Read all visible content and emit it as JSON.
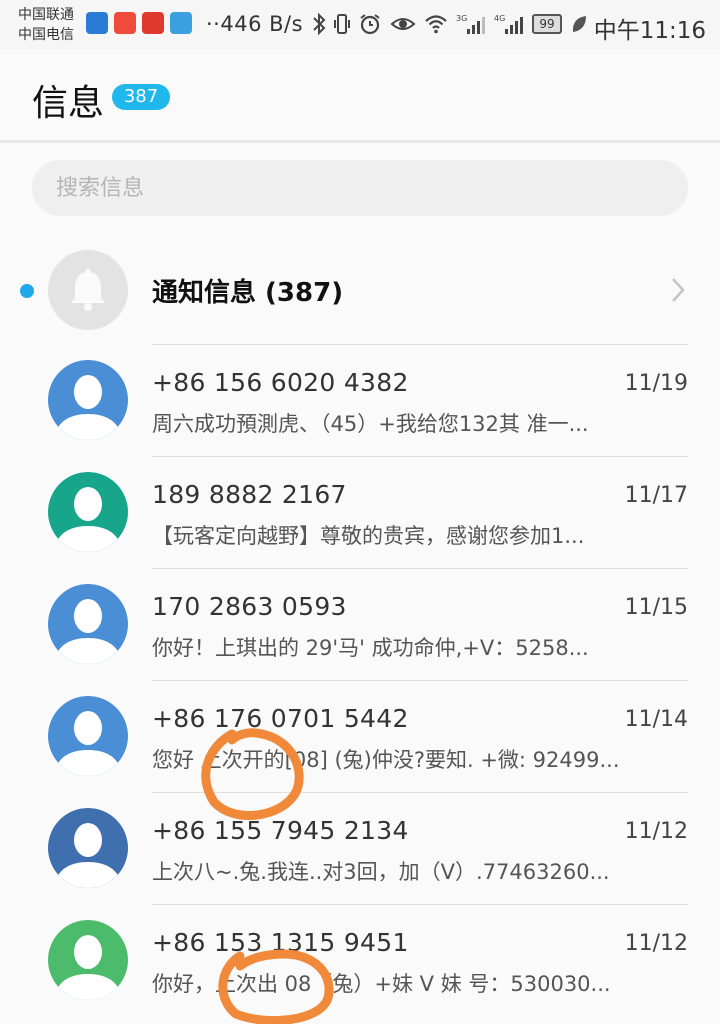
{
  "status_bar": {
    "carrier_1": "中国联通",
    "carrier_2": "中国电信",
    "net_speed": "··446 B/s",
    "battery": "99",
    "time": "中午11:16",
    "app_icon_colors": [
      "#2b7bd6",
      "#f04a3a",
      "#e03a2e",
      "#3aa0e0"
    ],
    "app_icon_names": [
      "app-icon",
      "app-icon",
      "news-app-icon",
      "app-icon"
    ]
  },
  "header": {
    "title": "信息",
    "badge": "387"
  },
  "search": {
    "placeholder": "搜索信息"
  },
  "notification": {
    "label": "通知信息 (387)"
  },
  "messages": [
    {
      "sender": "+86 156 6020 4382",
      "date": "11/19",
      "preview": "周六成功預測虎、（45）+我给您132其 准一...",
      "avatar_color": "#4a8fd6"
    },
    {
      "sender": "189 8882 2167",
      "date": "11/17",
      "preview": "【玩客定向越野】尊敬的贵宾，感谢您参加1...",
      "avatar_color": "#17a58c"
    },
    {
      "sender": "170 2863 0593",
      "date": "11/15",
      "preview": "你好！上琪出的 29'马' 成功命仲,+V：5258...",
      "avatar_color": "#4a8fd6"
    },
    {
      "sender": "+86 176 0701 5442",
      "date": "11/14",
      "preview": "您好 上次开的[08] (兔)仲没?要知. +微: 92499...",
      "avatar_color": "#4a8fd6"
    },
    {
      "sender": "+86 155 7945 2134",
      "date": "11/12",
      "preview": "上次八~.兔.我连..对3回，加（V）.77463260...",
      "avatar_color": "#3f6fae"
    },
    {
      "sender": "+86 153 1315 9451",
      "date": "11/12",
      "preview": "你好，上次出 08（兔）+妹 V 妹 号：530030...",
      "avatar_color": "#4cbb6c"
    }
  ],
  "colors": {
    "accent": "#1fb7ec",
    "unread_dot": "#21a8ea",
    "annotation": "#f08a3a"
  }
}
